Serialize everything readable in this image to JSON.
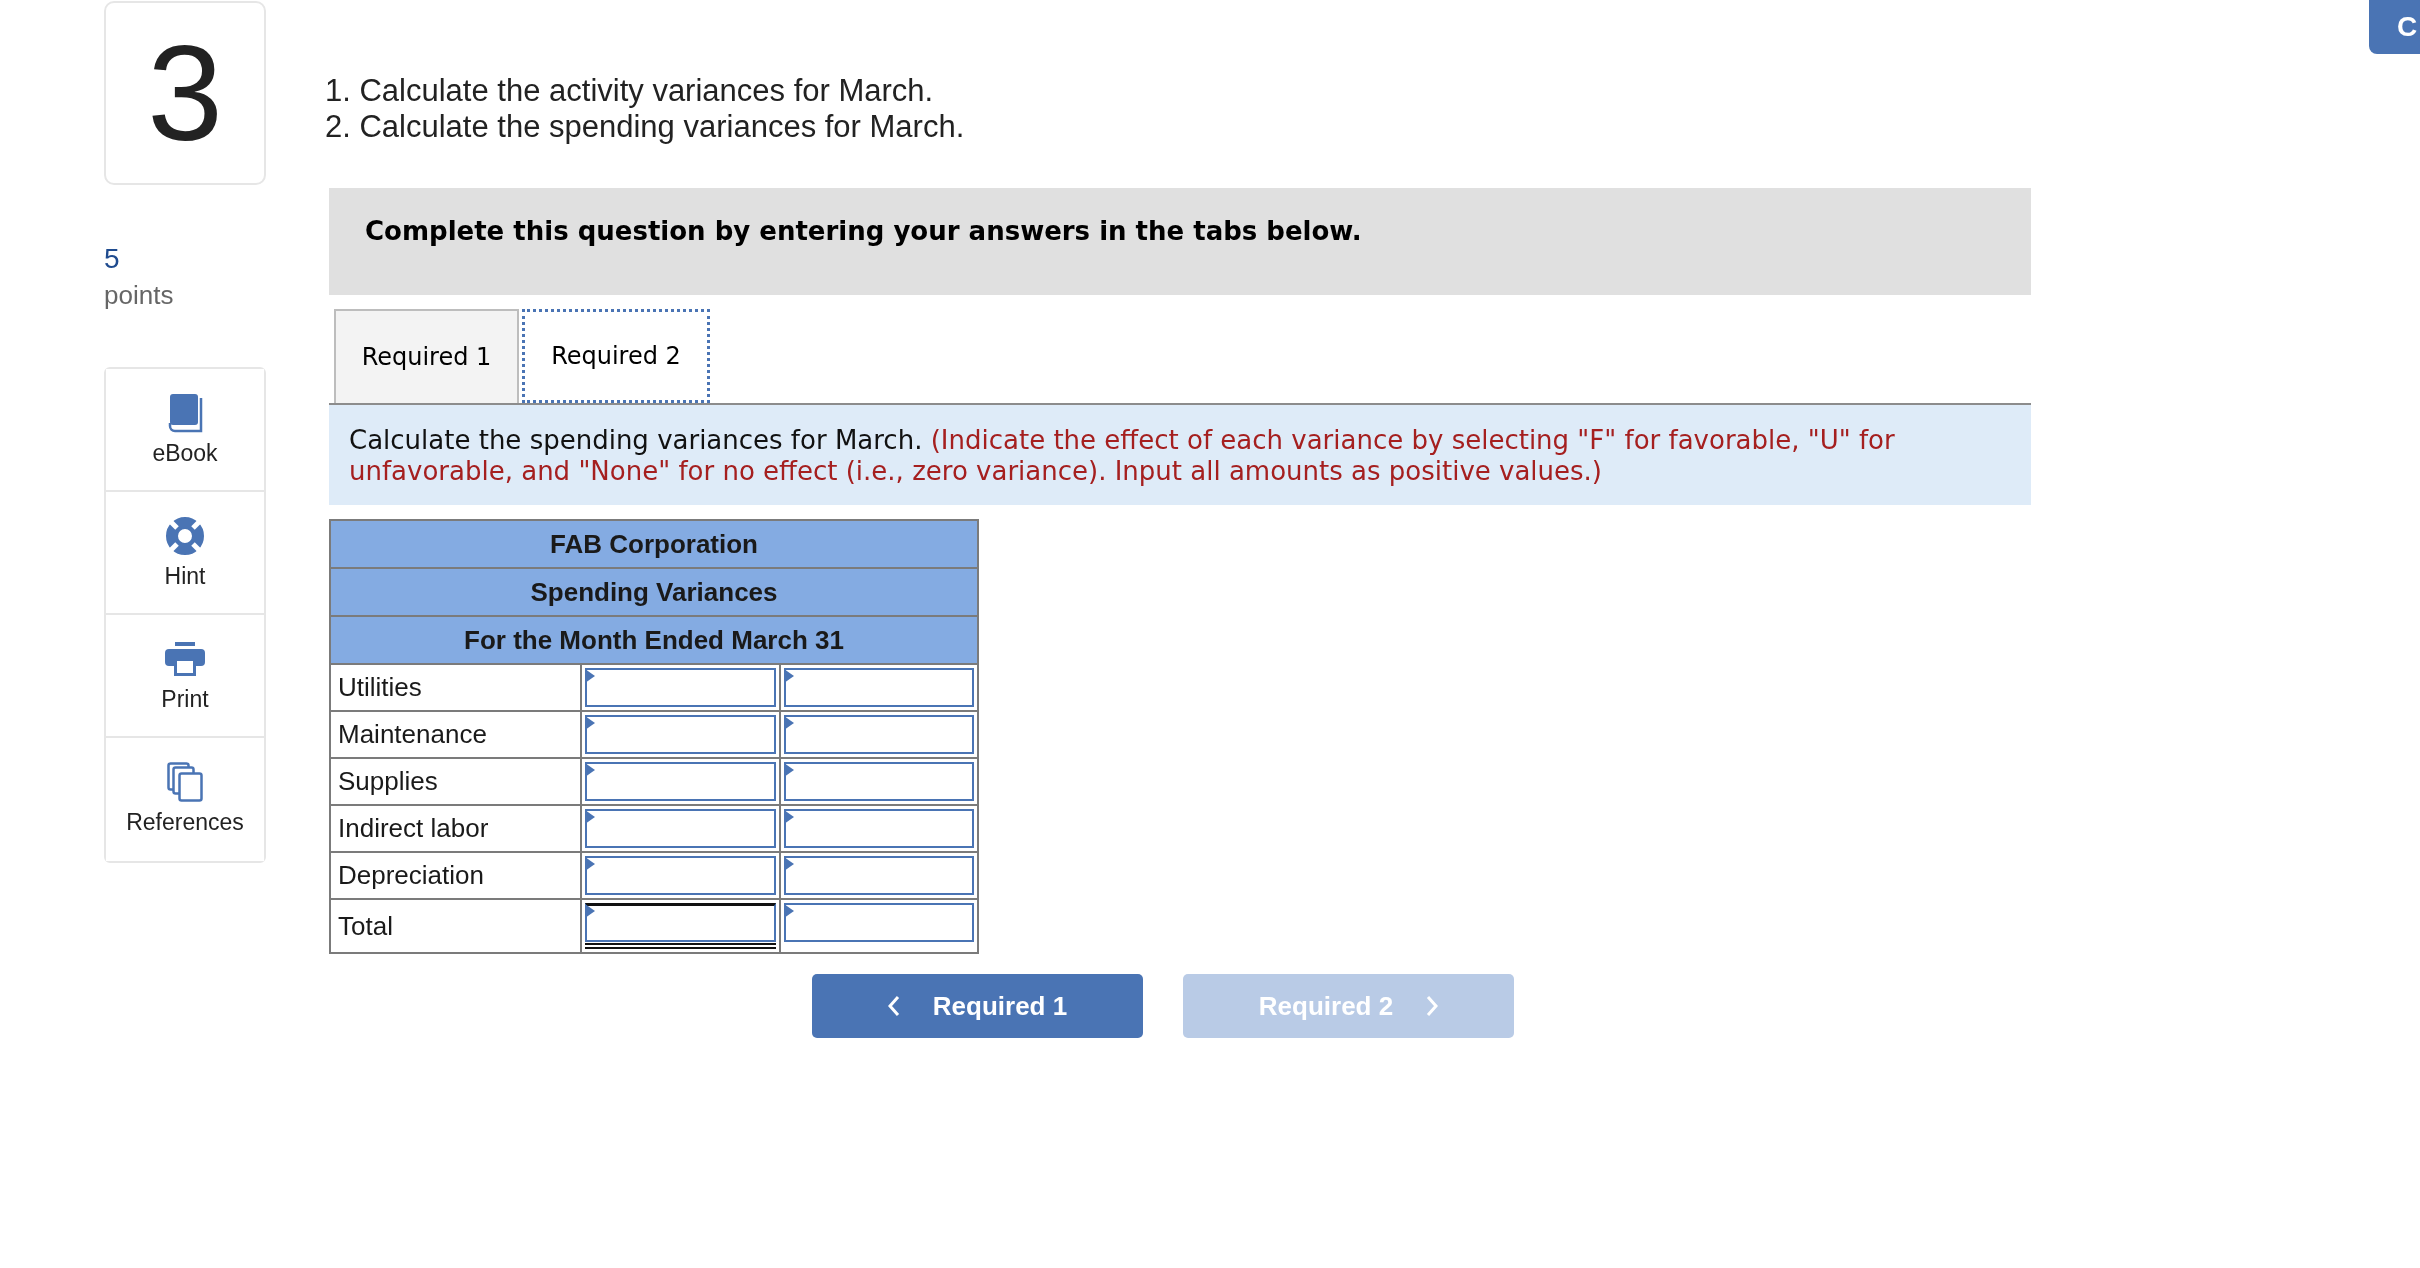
{
  "question": {
    "number": "3",
    "points_value": "5",
    "points_label": "points"
  },
  "tools": [
    {
      "label": "eBook",
      "kind": "book"
    },
    {
      "label": "Hint",
      "kind": "hint"
    },
    {
      "label": "Print",
      "kind": "print"
    },
    {
      "label": "References",
      "kind": "references"
    }
  ],
  "instructions": [
    "1. Calculate the activity variances for March.",
    "2. Calculate the spending variances for March."
  ],
  "banner": "Complete this question by entering your answers in the tabs below.",
  "tabs": [
    {
      "label": "Required 1",
      "selected": false
    },
    {
      "label": "Required 2",
      "selected": true
    }
  ],
  "prompt": {
    "text": "Calculate the spending variances for March.",
    "note": "(Indicate the effect of each variance by selecting \"F\" for favorable, \"U\" for unfavorable, and \"None\" for no effect (i.e., zero variance). Input all amounts as positive values.)"
  },
  "table": {
    "title_rows": [
      "FAB Corporation",
      "Spending Variances",
      "For the Month Ended March 31"
    ],
    "rows": [
      {
        "label": "Utilities",
        "kind": "line"
      },
      {
        "label": "Maintenance",
        "kind": "line"
      },
      {
        "label": "Supplies",
        "kind": "line"
      },
      {
        "label": "Indirect labor",
        "kind": "line"
      },
      {
        "label": "Depreciation",
        "kind": "line"
      },
      {
        "label": "Total",
        "kind": "total"
      }
    ]
  },
  "nav_buttons": [
    {
      "label": "Required 1",
      "kind": "prev",
      "disabled": false
    },
    {
      "label": "Required 2",
      "kind": "next",
      "disabled": true
    }
  ],
  "corner_button": {
    "label": "C"
  }
}
